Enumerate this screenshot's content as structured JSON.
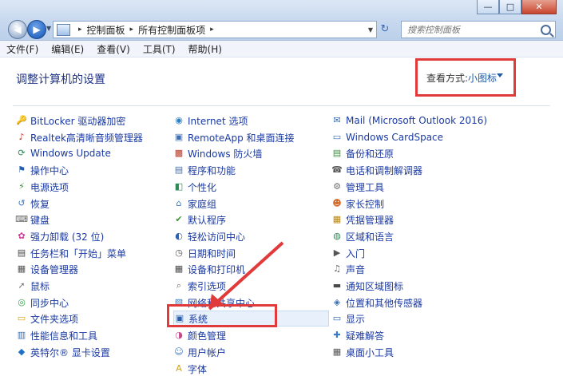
{
  "window": {
    "minimize_glyph": "—",
    "maximize_glyph": "□",
    "close_glyph": "✕"
  },
  "nav": {
    "back_glyph": "◀",
    "forward_glyph": "▶",
    "recent_glyph": "▼"
  },
  "address": {
    "separator": "▸",
    "crumbs": [
      "控制面板",
      "所有控制面板项"
    ],
    "dropdown_glyph": "▼",
    "refresh_glyph": "↻"
  },
  "search": {
    "placeholder": "搜索控制面板"
  },
  "menu": [
    "文件(F)",
    "编辑(E)",
    "查看(V)",
    "工具(T)",
    "帮助(H)"
  ],
  "page_title": "调整计算机的设置",
  "view_by": {
    "label": "查看方式:",
    "value": "小图标"
  },
  "highlight_color": "#e03a3a",
  "selected_item": "系统",
  "columns": [
    [
      {
        "label": "BitLocker 驱动器加密",
        "icon": "bitlocker-icon",
        "color": "#b8860b"
      },
      {
        "label": "Realtek高清晰音频管理器",
        "icon": "realtek-icon",
        "color": "#c0392b"
      },
      {
        "label": "Windows Update",
        "icon": "windows-update-icon",
        "color": "#2e8b57"
      },
      {
        "label": "操作中心",
        "icon": "action-center-flag-icon",
        "color": "#1f5fb3"
      },
      {
        "label": "电源选项",
        "icon": "power-options-icon",
        "color": "#3a8a3a"
      },
      {
        "label": "恢复",
        "icon": "recovery-icon",
        "color": "#3a76c4"
      },
      {
        "label": "键盘",
        "icon": "keyboard-icon",
        "color": "#666666"
      },
      {
        "label": "强力卸载 (32 位)",
        "icon": "uninstall-icon",
        "color": "#d33a9a"
      },
      {
        "label": "任务栏和「开始」菜单",
        "icon": "taskbar-icon",
        "color": "#444444"
      },
      {
        "label": "设备管理器",
        "icon": "device-manager-icon",
        "color": "#555555"
      },
      {
        "label": "鼠标",
        "icon": "mouse-icon",
        "color": "#777777"
      },
      {
        "label": "同步中心",
        "icon": "sync-center-icon",
        "color": "#2f9e44"
      },
      {
        "label": "文件夹选项",
        "icon": "folder-options-icon",
        "color": "#d4a017"
      },
      {
        "label": "性能信息和工具",
        "icon": "performance-icon",
        "color": "#3a6fb0"
      },
      {
        "label": "英特尔® 显卡设置",
        "icon": "intel-graphics-icon",
        "color": "#1f6fc4"
      }
    ],
    [
      {
        "label": "Internet 选项",
        "icon": "internet-options-icon",
        "color": "#2d7fc1"
      },
      {
        "label": "RemoteApp 和桌面连接",
        "icon": "remoteapp-icon",
        "color": "#3d6fb5"
      },
      {
        "label": "Windows 防火墙",
        "icon": "firewall-icon",
        "color": "#b83a2a"
      },
      {
        "label": "程序和功能",
        "icon": "programs-icon",
        "color": "#4a6fa5"
      },
      {
        "label": "个性化",
        "icon": "personalization-icon",
        "color": "#2e8b57"
      },
      {
        "label": "家庭组",
        "icon": "homegroup-icon",
        "color": "#2f7dc8"
      },
      {
        "label": "默认程序",
        "icon": "default-programs-icon",
        "color": "#3a9a3a"
      },
      {
        "label": "轻松访问中心",
        "icon": "ease-of-access-icon",
        "color": "#2a63b6"
      },
      {
        "label": "日期和时间",
        "icon": "date-time-icon",
        "color": "#555555"
      },
      {
        "label": "设备和打印机",
        "icon": "devices-printers-icon",
        "color": "#4b4b4b"
      },
      {
        "label": "索引选项",
        "icon": "indexing-icon",
        "color": "#6b6b6b"
      },
      {
        "label": "网络和共享中心",
        "icon": "network-icon",
        "color": "#3a7ac8"
      },
      {
        "label": "系统",
        "icon": "system-icon",
        "color": "#2b5fa8"
      },
      {
        "label": "颜色管理",
        "icon": "color-management-icon",
        "color": "#c44b8a"
      },
      {
        "label": "用户帐户",
        "icon": "user-accounts-icon",
        "color": "#3a7ac8"
      },
      {
        "label": "字体",
        "icon": "fonts-icon",
        "color": "#d4a017"
      }
    ],
    [
      {
        "label": "Mail (Microsoft Outlook 2016)",
        "icon": "mail-icon",
        "color": "#2a67b8"
      },
      {
        "label": "Windows CardSpace",
        "icon": "cardspace-icon",
        "color": "#3a6fb0"
      },
      {
        "label": "备份和还原",
        "icon": "backup-icon",
        "color": "#3a8a3a"
      },
      {
        "label": "电话和调制解调器",
        "icon": "phone-modem-icon",
        "color": "#555555"
      },
      {
        "label": "管理工具",
        "icon": "admin-tools-icon",
        "color": "#6b6b6b"
      },
      {
        "label": "家长控制",
        "icon": "parental-controls-icon",
        "color": "#d36a2a"
      },
      {
        "label": "凭据管理器",
        "icon": "credential-manager-icon",
        "color": "#b8860b"
      },
      {
        "label": "区域和语言",
        "icon": "region-language-icon",
        "color": "#2e8b57"
      },
      {
        "label": "入门",
        "icon": "getting-started-icon",
        "color": "#555555"
      },
      {
        "label": "声音",
        "icon": "sound-icon",
        "color": "#666666"
      },
      {
        "label": "通知区域图标",
        "icon": "notification-icons-icon",
        "color": "#4a4a4a"
      },
      {
        "label": "位置和其他传感器",
        "icon": "location-sensors-icon",
        "color": "#3a6fb0"
      },
      {
        "label": "显示",
        "icon": "display-icon",
        "color": "#2a67b8"
      },
      {
        "label": "疑难解答",
        "icon": "troubleshooting-icon",
        "color": "#3a7ac8"
      },
      {
        "label": "桌面小工具",
        "icon": "gadgets-icon",
        "color": "#555555"
      }
    ]
  ]
}
